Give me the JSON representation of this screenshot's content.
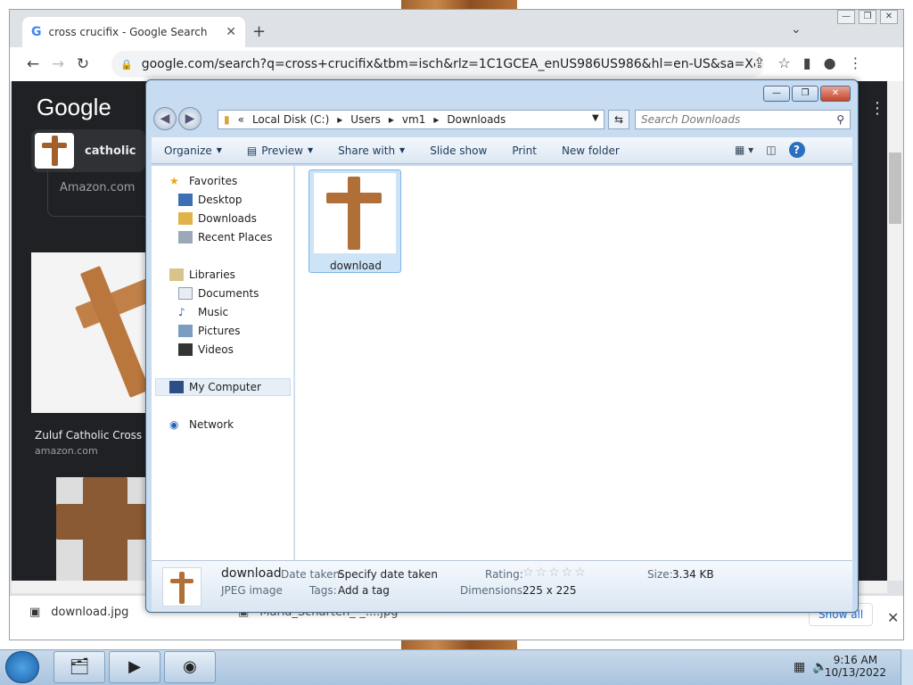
{
  "browser": {
    "tab_title": "cross crucifix - Google Search",
    "new_tab": "+",
    "address": "google.com/search?q=cross+crucifix&tbm=isch&rlz=1C1GCEA_enUS986US986&hl=en-US&sa=X&ved=2a...",
    "page": {
      "logo": "Google",
      "chip_label": "catholic",
      "result1_source": "Amazon.com",
      "result2_title": "Zuluf Catholic Cross Cr",
      "result2_source": "amazon.com"
    },
    "downloads": [
      {
        "name": "download.jpg"
      },
      {
        "name": "Maria_Scharten_-_....jpg"
      }
    ],
    "show_all": "Show all"
  },
  "explorer": {
    "breadcrumb": [
      "«",
      "Local Disk (C:)",
      "Users",
      "vm1",
      "Downloads"
    ],
    "search_placeholder": "Search Downloads",
    "commands": {
      "organize": "Organize",
      "preview": "Preview",
      "share": "Share with",
      "slideshow": "Slide show",
      "print": "Print",
      "new_folder": "New folder"
    },
    "nav": {
      "favorites": "Favorites",
      "desktop": "Desktop",
      "downloads": "Downloads",
      "recent": "Recent Places",
      "libraries": "Libraries",
      "documents": "Documents",
      "music": "Music",
      "pictures": "Pictures",
      "videos": "Videos",
      "computer": "My Computer",
      "network": "Network"
    },
    "file": {
      "name": "download"
    },
    "details": {
      "name": "download",
      "type": "JPEG image",
      "date_label": "Date taken:",
      "date_value": "Specify date taken",
      "tags_label": "Tags:",
      "tags_value": "Add a tag",
      "rating_label": "Rating:",
      "rating_value": 0,
      "dims_label": "Dimensions:",
      "dims_value": "225 x 225",
      "size_label": "Size:",
      "size_value": "3.34 KB"
    }
  },
  "taskbar": {
    "time": "9:16 AM",
    "date": "10/13/2022"
  },
  "colors": {
    "accent": "#1a73e8",
    "wood": "#b77336",
    "explorer_frame": "#c7dcf1"
  }
}
